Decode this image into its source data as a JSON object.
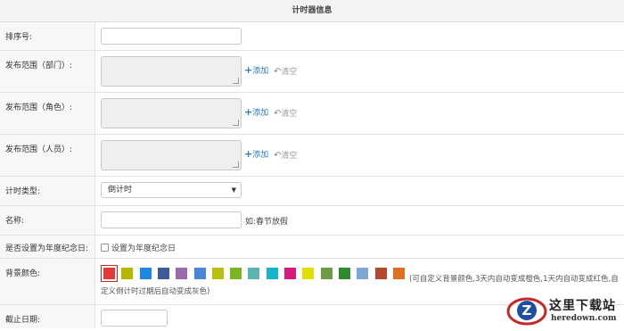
{
  "header": {
    "title": "计时器信息"
  },
  "rows": {
    "order": {
      "label": "排序号:",
      "value": ""
    },
    "dept": {
      "label": "发布范围（部门）:",
      "add": "添加",
      "clear": "清空"
    },
    "role": {
      "label": "发布范围（角色）:",
      "add": "添加",
      "clear": "清空"
    },
    "person": {
      "label": "发布范围（人员）:",
      "add": "添加",
      "clear": "清空"
    },
    "timer_type": {
      "label": "计时类型:",
      "selected": "倒计时"
    },
    "name": {
      "label": "名称:",
      "value": "",
      "hint": "如:春节放假"
    },
    "anniversary": {
      "label": "是否设置为年度纪念日:",
      "checkbox_label": "设置为年度纪念日",
      "checked": false
    },
    "bg_color": {
      "label": "背景颜色:",
      "colors": [
        "#e53935",
        "#b5b800",
        "#1e88e5",
        "#3d5a99",
        "#9b6aad",
        "#4a86d6",
        "#b7bf10",
        "#7cb51f",
        "#5ab4b0",
        "#15b3cc",
        "#d81b7a",
        "#e0e000",
        "#6e9a44",
        "#2e8b2e",
        "#7ea6d6",
        "#b5482e",
        "#e07020"
      ],
      "selected_index": 0,
      "note_line1": "(可自定义背景颜色,3天内自动变成橙色,1天内自动变成红色,自",
      "note_line2": "定义倒计时过期后自动变成灰色)"
    },
    "deadline": {
      "label": "截止日期:",
      "value": ""
    }
  },
  "watermark": {
    "title": "这里下载站",
    "url": "heredown.com"
  }
}
